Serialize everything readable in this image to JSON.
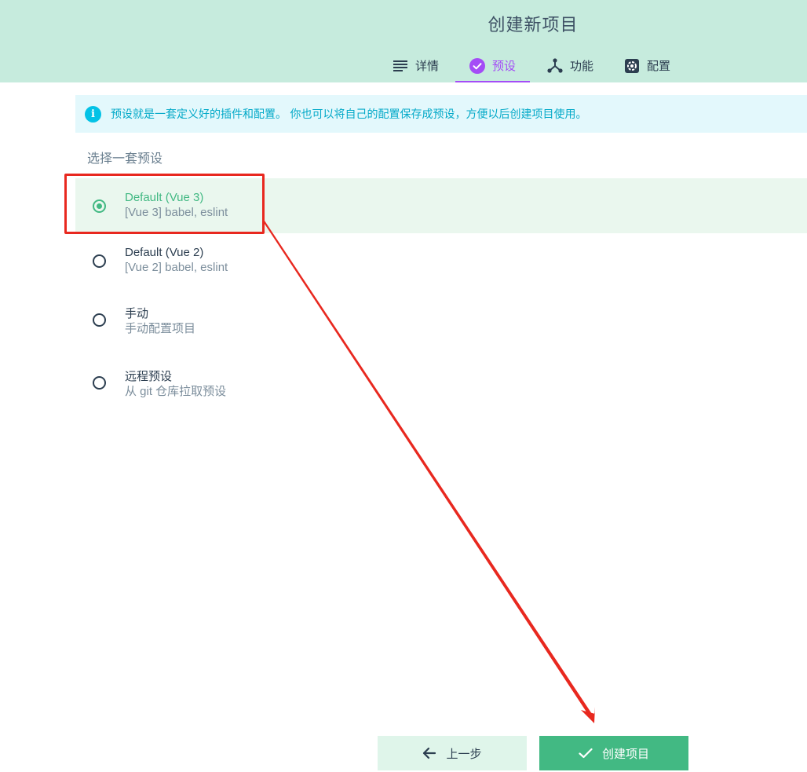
{
  "header": {
    "title": "创建新项目",
    "tabs": [
      {
        "label": "详情",
        "icon": "list-icon"
      },
      {
        "label": "预设",
        "icon": "check-circle-icon",
        "active": true
      },
      {
        "label": "功能",
        "icon": "fork-icon"
      },
      {
        "label": "配置",
        "icon": "gear-icon"
      }
    ]
  },
  "info": {
    "icon": "info-icon",
    "text": "预设就是一套定义好的插件和配置。 你也可以将自己的配置保存成预设，方便以后创建项目使用。"
  },
  "presets_section": {
    "title": "选择一套预设",
    "items": [
      {
        "name": "Default (Vue 3)",
        "desc": "[Vue 3] babel, eslint",
        "selected": true
      },
      {
        "name": "Default (Vue 2)",
        "desc": "[Vue 2] babel, eslint",
        "selected": false
      },
      {
        "name": "手动",
        "desc": "手动配置项目",
        "selected": false
      },
      {
        "name": "远程预设",
        "desc": "从 git 仓库拉取预设",
        "selected": false
      }
    ]
  },
  "actions": {
    "prev_label": "上一步",
    "create_label": "创建项目"
  },
  "colors": {
    "header_bg": "#c6ebdd",
    "accent_purple": "#a44cf6",
    "accent_green": "#42b983",
    "info_cyan": "#03c2e6",
    "annotation_red": "#e8281f"
  }
}
